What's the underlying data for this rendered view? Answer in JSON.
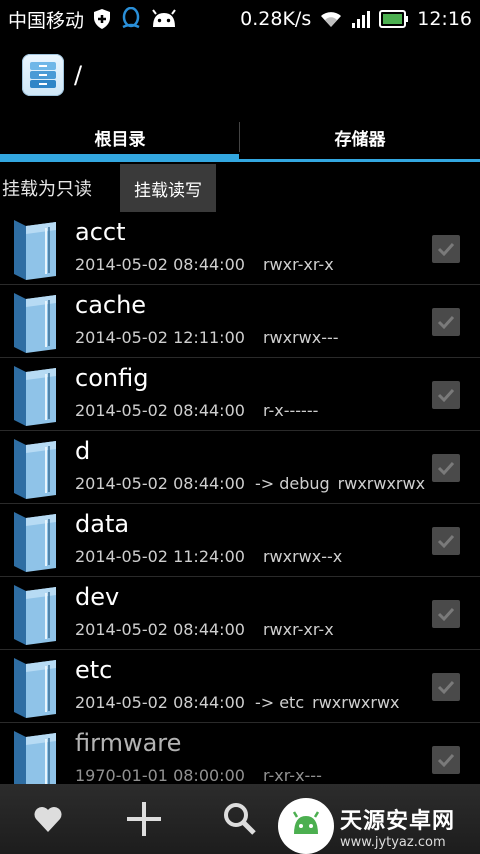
{
  "status_bar": {
    "carrier": "中国移动",
    "net_speed": "0.28K/s",
    "time": "12:16",
    "icons": [
      "shield-icon",
      "qq-icon",
      "android-icon",
      "wifi-icon",
      "signal-icon",
      "battery-icon"
    ],
    "battery_color": "#4caf50"
  },
  "header": {
    "path": "/"
  },
  "tabs": [
    {
      "label": "根目录",
      "active": true
    },
    {
      "label": "存储器",
      "active": false
    }
  ],
  "accent_color": "#33a7e0",
  "mount": {
    "read_only_label": "挂载为只读",
    "read_write_label": "挂载读写"
  },
  "files": [
    {
      "name": "acct",
      "date": "2014-05-02 08:44:00",
      "link": "",
      "perm": "rwxr-xr-x"
    },
    {
      "name": "cache",
      "date": "2014-05-02 12:11:00",
      "link": "",
      "perm": "rwxrwx---"
    },
    {
      "name": "config",
      "date": "2014-05-02 08:44:00",
      "link": "",
      "perm": "r-x------"
    },
    {
      "name": "d",
      "date": "2014-05-02 08:44:00",
      "link": "-> debug",
      "perm": "rwxrwxrwx"
    },
    {
      "name": "data",
      "date": "2014-05-02 11:24:00",
      "link": "",
      "perm": "rwxrwx--x"
    },
    {
      "name": "dev",
      "date": "2014-05-02 08:44:00",
      "link": "",
      "perm": "rwxr-xr-x"
    },
    {
      "name": "etc",
      "date": "2014-05-02 08:44:00",
      "link": "-> etc",
      "perm": "rwxrwxrwx"
    },
    {
      "name": "firmware",
      "date": "1970-01-01 08:00:00",
      "link": "",
      "perm": "r-xr-x---"
    }
  ],
  "bottom_bar": {
    "icons": [
      "favorite-heart-icon",
      "add-icon",
      "search-icon"
    ]
  },
  "watermark": {
    "title": "天源安卓网",
    "url": "www.jytyaz.com"
  }
}
